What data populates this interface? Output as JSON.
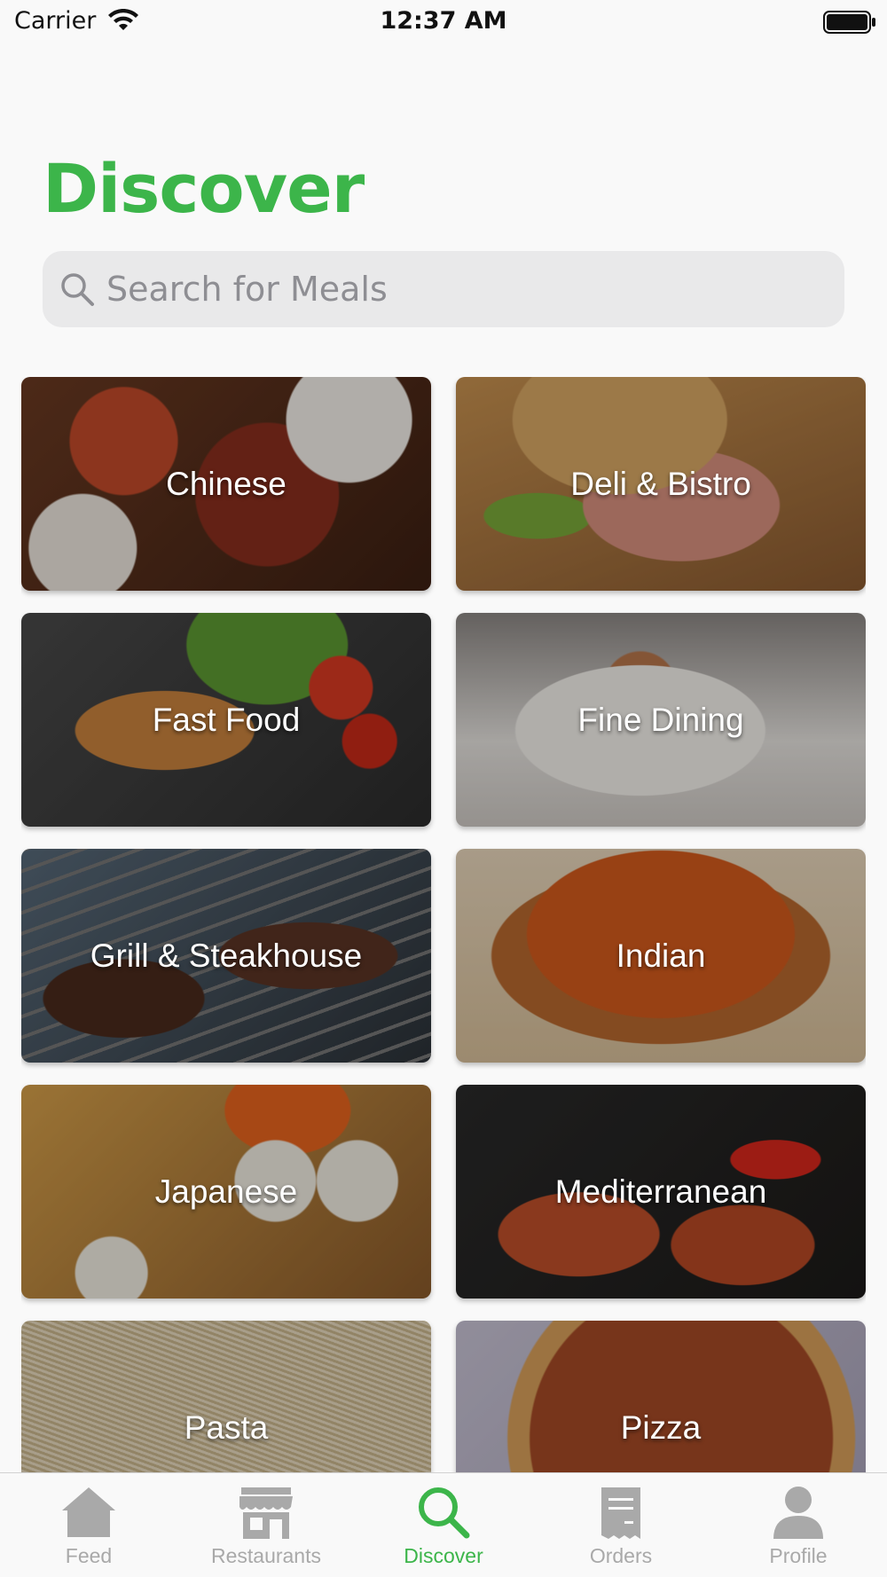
{
  "status_bar": {
    "carrier": "Carrier",
    "time": "12:37 AM"
  },
  "page": {
    "title": "Discover"
  },
  "search": {
    "placeholder": "Search for Meals",
    "value": ""
  },
  "categories": [
    {
      "label": "Chinese"
    },
    {
      "label": "Deli & Bistro"
    },
    {
      "label": "Fast Food"
    },
    {
      "label": "Fine Dining"
    },
    {
      "label": "Grill & Steakhouse"
    },
    {
      "label": "Indian"
    },
    {
      "label": "Japanese"
    },
    {
      "label": "Mediterranean"
    },
    {
      "label": "Pasta"
    },
    {
      "label": "Pizza"
    }
  ],
  "tab_bar": {
    "items": [
      {
        "label": "Feed",
        "icon": "house-icon",
        "active": false
      },
      {
        "label": "Restaurants",
        "icon": "storefront-icon",
        "active": false
      },
      {
        "label": "Discover",
        "icon": "search-icon",
        "active": true
      },
      {
        "label": "Orders",
        "icon": "receipt-icon",
        "active": false
      },
      {
        "label": "Profile",
        "icon": "person-icon",
        "active": false
      }
    ]
  },
  "colors": {
    "accent": "#3cb54a",
    "inactive_tab": "#a9a9a9",
    "search_background": "#e9e9ea",
    "background": "#f9f9f9"
  }
}
